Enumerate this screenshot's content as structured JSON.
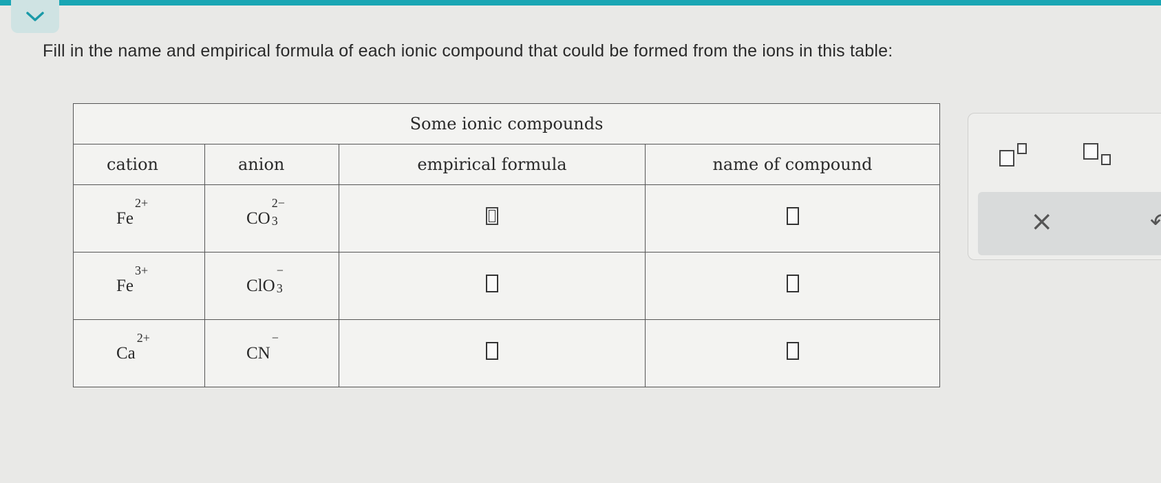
{
  "question": {
    "text": "Fill in the name and empirical formula of each ionic compound that could be formed from the ions in this table:"
  },
  "table": {
    "caption": "Some ionic compounds",
    "headers": [
      "cation",
      "anion",
      "empirical formula",
      "name of compound"
    ],
    "rows": [
      {
        "cation": {
          "base": "Fe",
          "charge": "2+"
        },
        "anion": {
          "base": "CO",
          "sub": "3",
          "charge": "2−"
        }
      },
      {
        "cation": {
          "base": "Fe",
          "charge": "3+"
        },
        "anion": {
          "base": "ClO",
          "sub": "3",
          "charge": "−"
        }
      },
      {
        "cation": {
          "base": "Ca",
          "charge": "2+"
        },
        "anion": {
          "base": "CN",
          "sub": "",
          "charge": "−"
        }
      }
    ]
  },
  "toolbar": {
    "superscript_icon": "superscript-template-icon",
    "subscript_icon": "subscript-template-icon",
    "clear_label": "×",
    "undo_label": "↶"
  },
  "colors": {
    "accent": "#1aa6b4",
    "panel": "#d9dbdb"
  }
}
